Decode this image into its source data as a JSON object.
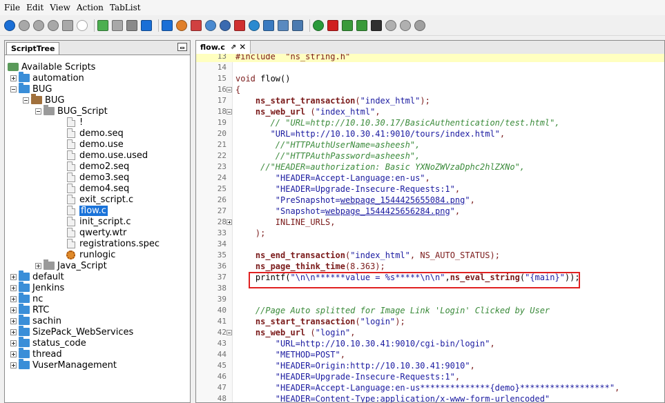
{
  "menu": [
    "File",
    "Edit",
    "View",
    "Action",
    "TabList"
  ],
  "toolbar_icons": [
    {
      "name": "play-icon",
      "shape": "circle",
      "color": "#1a6fd6"
    },
    {
      "name": "stop-icon",
      "shape": "circle",
      "color": "#a8a8a8"
    },
    {
      "name": "abort-icon",
      "shape": "circle",
      "color": "#a8a8a8"
    },
    {
      "name": "pause-icon",
      "shape": "circle",
      "color": "#a8a8a8"
    },
    {
      "name": "step-icon",
      "shape": "sq",
      "color": "#a8a8a8"
    },
    {
      "name": "comment-icon",
      "shape": "circle",
      "color": "#ffffff"
    },
    {
      "name": "add-page-icon",
      "shape": "sq",
      "color": "#4caf50"
    },
    {
      "name": "save-disabled-icon",
      "shape": "sq",
      "color": "#a8a8a8"
    },
    {
      "name": "copy-icon",
      "shape": "sq",
      "color": "#8a8a8a"
    },
    {
      "name": "download-icon",
      "shape": "sq",
      "color": "#1a6fd6"
    },
    {
      "name": "upload-icon",
      "shape": "sq",
      "color": "#1a6fd6"
    },
    {
      "name": "settings-icon",
      "shape": "circle",
      "color": "#e0802a"
    },
    {
      "name": "edit-icon",
      "shape": "sq",
      "color": "#d04040"
    },
    {
      "name": "search-icon",
      "shape": "circle",
      "color": "#4a8ad0"
    },
    {
      "name": "gear-icon",
      "shape": "circle",
      "color": "#3a6ab0"
    },
    {
      "name": "checkpoint-icon",
      "shape": "sq",
      "color": "#d03030"
    },
    {
      "name": "globe-icon",
      "shape": "circle",
      "color": "#2a8ad0"
    },
    {
      "name": "database-icon",
      "shape": "sq",
      "color": "#3a7ac0"
    },
    {
      "name": "monitor-icon",
      "shape": "sq",
      "color": "#5a8ac0"
    },
    {
      "name": "window-icon",
      "shape": "sq",
      "color": "#4a7ab0"
    },
    {
      "name": "refresh-icon",
      "shape": "circle",
      "color": "#2a9a3a"
    },
    {
      "name": "power-icon",
      "shape": "sq",
      "color": "#d02020"
    },
    {
      "name": "import-icon",
      "shape": "sq",
      "color": "#3a9a3a"
    },
    {
      "name": "export-icon",
      "shape": "sq",
      "color": "#3a9a3a"
    },
    {
      "name": "floppy-icon",
      "shape": "sq",
      "color": "#303030"
    },
    {
      "name": "undo-icon",
      "shape": "circle",
      "color": "#b0b0b0"
    },
    {
      "name": "forward-icon",
      "shape": "circle",
      "color": "#b0b0b0"
    },
    {
      "name": "stop-square-icon",
      "shape": "circle",
      "color": "#a0a0a0"
    }
  ],
  "left_panel": {
    "tab": "ScriptTree",
    "root": "Available Scripts",
    "nodes": [
      {
        "label": "automation",
        "depth": 1,
        "exp": "plus",
        "icon": "folder"
      },
      {
        "label": "BUG",
        "depth": 1,
        "exp": "minus",
        "icon": "folder"
      },
      {
        "label": "BUG",
        "depth": 2,
        "exp": "minus",
        "icon": "bfolder"
      },
      {
        "label": "BUG_Script",
        "depth": 3,
        "exp": "minus",
        "icon": "gfolder"
      },
      {
        "label": "!",
        "depth": 4,
        "exp": "none",
        "icon": "file"
      },
      {
        "label": "demo.seq",
        "depth": 4,
        "exp": "none",
        "icon": "file"
      },
      {
        "label": "demo.use",
        "depth": 4,
        "exp": "none",
        "icon": "file"
      },
      {
        "label": "demo.use.used",
        "depth": 4,
        "exp": "none",
        "icon": "file"
      },
      {
        "label": "demo2.seq",
        "depth": 4,
        "exp": "none",
        "icon": "file"
      },
      {
        "label": "demo3.seq",
        "depth": 4,
        "exp": "none",
        "icon": "file"
      },
      {
        "label": "demo4.seq",
        "depth": 4,
        "exp": "none",
        "icon": "file"
      },
      {
        "label": "exit_script.c",
        "depth": 4,
        "exp": "none",
        "icon": "file"
      },
      {
        "label": "flow.c",
        "depth": 4,
        "exp": "none",
        "icon": "file",
        "selected": true
      },
      {
        "label": "init_script.c",
        "depth": 4,
        "exp": "none",
        "icon": "file"
      },
      {
        "label": "qwerty.wtr",
        "depth": 4,
        "exp": "none",
        "icon": "file"
      },
      {
        "label": "registrations.spec",
        "depth": 4,
        "exp": "none",
        "icon": "file"
      },
      {
        "label": "runlogic",
        "depth": 4,
        "exp": "none",
        "icon": "gear"
      },
      {
        "label": "Java_Script",
        "depth": 3,
        "exp": "plus",
        "icon": "gfolder"
      },
      {
        "label": "default",
        "depth": 1,
        "exp": "plus",
        "icon": "folder"
      },
      {
        "label": "Jenkins",
        "depth": 1,
        "exp": "plus",
        "icon": "folder"
      },
      {
        "label": "nc",
        "depth": 1,
        "exp": "plus",
        "icon": "folder"
      },
      {
        "label": "RTC",
        "depth": 1,
        "exp": "plus",
        "icon": "folder"
      },
      {
        "label": "sachin",
        "depth": 1,
        "exp": "plus",
        "icon": "folder"
      },
      {
        "label": "SizePack_WebServices",
        "depth": 1,
        "exp": "plus",
        "icon": "folder"
      },
      {
        "label": "status_code",
        "depth": 1,
        "exp": "plus",
        "icon": "folder"
      },
      {
        "label": "thread",
        "depth": 1,
        "exp": "plus",
        "icon": "folder"
      },
      {
        "label": "VuserManagement",
        "depth": 1,
        "exp": "plus",
        "icon": "folder"
      }
    ]
  },
  "editor": {
    "tab": "flow.c",
    "pin": "⇗",
    "close": "✕",
    "lines": [
      {
        "n": "13",
        "fold": "",
        "hl": true,
        "segs": [
          [
            "kw",
            "#include  \"ns_string.h\""
          ]
        ]
      },
      {
        "n": "14",
        "fold": "",
        "segs": []
      },
      {
        "n": "15",
        "fold": "",
        "segs": [
          [
            "kw",
            "void "
          ],
          [
            "",
            "flow()"
          ]
        ]
      },
      {
        "n": "16",
        "fold": "minus",
        "segs": [
          [
            "kw",
            "{"
          ]
        ]
      },
      {
        "n": "17",
        "fold": "",
        "segs": [
          [
            "",
            "    "
          ],
          [
            "fn",
            "ns_start_transaction"
          ],
          [
            "kw",
            "("
          ],
          [
            "str",
            "\"index_html\""
          ],
          [
            "kw",
            ");"
          ]
        ]
      },
      {
        "n": "18",
        "fold": "minus",
        "segs": [
          [
            "",
            "    "
          ],
          [
            "fn",
            "ns_web_url"
          ],
          [
            "kw",
            " ("
          ],
          [
            "str",
            "\"index_html\""
          ],
          [
            "kw",
            ","
          ]
        ]
      },
      {
        "n": "19",
        "fold": "",
        "segs": [
          [
            "",
            "       "
          ],
          [
            "cm",
            "// \"URL=http://10.10.30.17/BasicAuthentication/test.html\","
          ]
        ]
      },
      {
        "n": "20",
        "fold": "",
        "segs": [
          [
            "",
            "       "
          ],
          [
            "str",
            "\"URL=http://10.10.30.41:9010/tours/index.html\""
          ],
          [
            "kw",
            ","
          ]
        ]
      },
      {
        "n": "21",
        "fold": "",
        "segs": [
          [
            "",
            "        "
          ],
          [
            "cm",
            "//\"HTTPAuthUserName=asheesh\","
          ]
        ]
      },
      {
        "n": "22",
        "fold": "",
        "segs": [
          [
            "",
            "        "
          ],
          [
            "cm",
            "//\"HTTPAuthPassword=asheesh\","
          ]
        ]
      },
      {
        "n": "23",
        "fold": "",
        "segs": [
          [
            "",
            "     "
          ],
          [
            "cm",
            "//\"HEADER=authorization: Basic YXNoZWVzaDphc2hlZXNo\","
          ]
        ]
      },
      {
        "n": "24",
        "fold": "",
        "segs": [
          [
            "",
            "        "
          ],
          [
            "str",
            "\"HEADER=Accept-Language:en-us\""
          ],
          [
            "kw",
            ","
          ]
        ]
      },
      {
        "n": "25",
        "fold": "",
        "segs": [
          [
            "",
            "        "
          ],
          [
            "str",
            "\"HEADER=Upgrade-Insecure-Requests:1\""
          ],
          [
            "kw",
            ","
          ]
        ]
      },
      {
        "n": "26",
        "fold": "",
        "segs": [
          [
            "",
            "        "
          ],
          [
            "str",
            "\"PreSnapshot="
          ],
          [
            "lnk",
            "webpage_1544425655084.png"
          ],
          [
            "str",
            "\""
          ],
          [
            "kw",
            ","
          ]
        ]
      },
      {
        "n": "27",
        "fold": "",
        "segs": [
          [
            "",
            "        "
          ],
          [
            "str",
            "\"Snapshot="
          ],
          [
            "lnk",
            "webpage_1544425656284.png"
          ],
          [
            "str",
            "\""
          ],
          [
            "kw",
            ","
          ]
        ]
      },
      {
        "n": "28",
        "fold": "plus",
        "segs": [
          [
            "",
            "        "
          ],
          [
            "kw",
            "INLINE_URLS,"
          ]
        ]
      },
      {
        "n": "33",
        "fold": "",
        "segs": [
          [
            "",
            "    "
          ],
          [
            "kw",
            ");"
          ]
        ]
      },
      {
        "n": "34",
        "fold": "",
        "segs": []
      },
      {
        "n": "35",
        "fold": "",
        "segs": [
          [
            "",
            "    "
          ],
          [
            "fn",
            "ns_end_transaction"
          ],
          [
            "kw",
            "("
          ],
          [
            "str",
            "\"index_html\""
          ],
          [
            "kw",
            ", NS_AUTO_STATUS);"
          ]
        ]
      },
      {
        "n": "36",
        "fold": "",
        "segs": [
          [
            "",
            "    "
          ],
          [
            "fn",
            "ns_page_think_time"
          ],
          [
            "kw",
            "(8.363);"
          ]
        ]
      },
      {
        "n": "37",
        "fold": "",
        "segs": [
          [
            "",
            "    "
          ],
          [
            "",
            "printf("
          ],
          [
            "str",
            "\"\\n\\n******value = %s*****\\n\\n\""
          ],
          [
            "",
            ","
          ],
          [
            "fn",
            "ns_eval_string"
          ],
          [
            "",
            "("
          ],
          [
            "str",
            "\"{main}\""
          ],
          [
            "",
            "));"
          ]
        ]
      },
      {
        "n": "38",
        "fold": "",
        "segs": []
      },
      {
        "n": "39",
        "fold": "",
        "segs": []
      },
      {
        "n": "40",
        "fold": "",
        "segs": [
          [
            "",
            "    "
          ],
          [
            "cm",
            "//Page Auto splitted for Image Link 'Login' Clicked by User"
          ]
        ]
      },
      {
        "n": "41",
        "fold": "",
        "segs": [
          [
            "",
            "    "
          ],
          [
            "fn",
            "ns_start_transaction"
          ],
          [
            "kw",
            "("
          ],
          [
            "str",
            "\"login\""
          ],
          [
            "kw",
            ");"
          ]
        ]
      },
      {
        "n": "42",
        "fold": "minus",
        "segs": [
          [
            "",
            "    "
          ],
          [
            "fn",
            "ns_web_url"
          ],
          [
            "kw",
            " ("
          ],
          [
            "str",
            "\"login\""
          ],
          [
            "kw",
            ","
          ]
        ]
      },
      {
        "n": "43",
        "fold": "",
        "segs": [
          [
            "",
            "        "
          ],
          [
            "str",
            "\"URL=http://10.10.30.41:9010/cgi-bin/login\""
          ],
          [
            "kw",
            ","
          ]
        ]
      },
      {
        "n": "44",
        "fold": "",
        "segs": [
          [
            "",
            "        "
          ],
          [
            "str",
            "\"METHOD=POST\""
          ],
          [
            "kw",
            ","
          ]
        ]
      },
      {
        "n": "45",
        "fold": "",
        "segs": [
          [
            "",
            "        "
          ],
          [
            "str",
            "\"HEADER=Origin:http://10.10.30.41:9010\""
          ],
          [
            "kw",
            ","
          ]
        ]
      },
      {
        "n": "46",
        "fold": "",
        "segs": [
          [
            "",
            "        "
          ],
          [
            "str",
            "\"HEADER=Upgrade-Insecure-Requests:1\""
          ],
          [
            "kw",
            ","
          ]
        ]
      },
      {
        "n": "47",
        "fold": "",
        "segs": [
          [
            "",
            "        "
          ],
          [
            "str",
            "\"HEADER=Accept-Language:en-us**************{demo}******************\""
          ],
          [
            "kw",
            ","
          ]
        ]
      },
      {
        "n": "48",
        "fold": "",
        "segs": [
          [
            "",
            "        "
          ],
          [
            "str",
            "\"HEADER=Content-Type:application/x-www-form-urlencoded\""
          ]
        ]
      }
    ]
  }
}
